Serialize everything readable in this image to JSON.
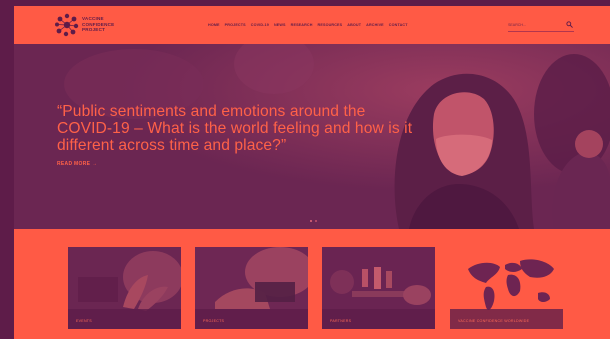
{
  "header": {
    "logo_lines": [
      "VACCINE",
      "CONFIDENCE",
      "PROJECT"
    ],
    "nav": [
      "HOME",
      "PROJECTS",
      "COVID-19",
      "NEWS",
      "RESEARCH",
      "RESOURCES",
      "ABOUT",
      "ARCHIVE",
      "CONTACT"
    ],
    "search": {
      "placeholder": "SEARCH...",
      "icon": "search-icon"
    }
  },
  "hero": {
    "quote": "“Public sentiments and emotions around the COVID-19 – What is the world feeling and how is it different across time and place?”",
    "read_more": "READ MORE →",
    "slide_count": 2,
    "active_slide": 1
  },
  "cards": [
    {
      "label": "EVENTS"
    },
    {
      "label": "PROJECTS"
    },
    {
      "label": "PARTNERS"
    },
    {
      "label": "VACCINE CONFIDENCE WORLDWIDE"
    }
  ],
  "colors": {
    "accent": "#ff5a45",
    "dark": "#5e1c49",
    "hero_text": "#ff6148"
  }
}
